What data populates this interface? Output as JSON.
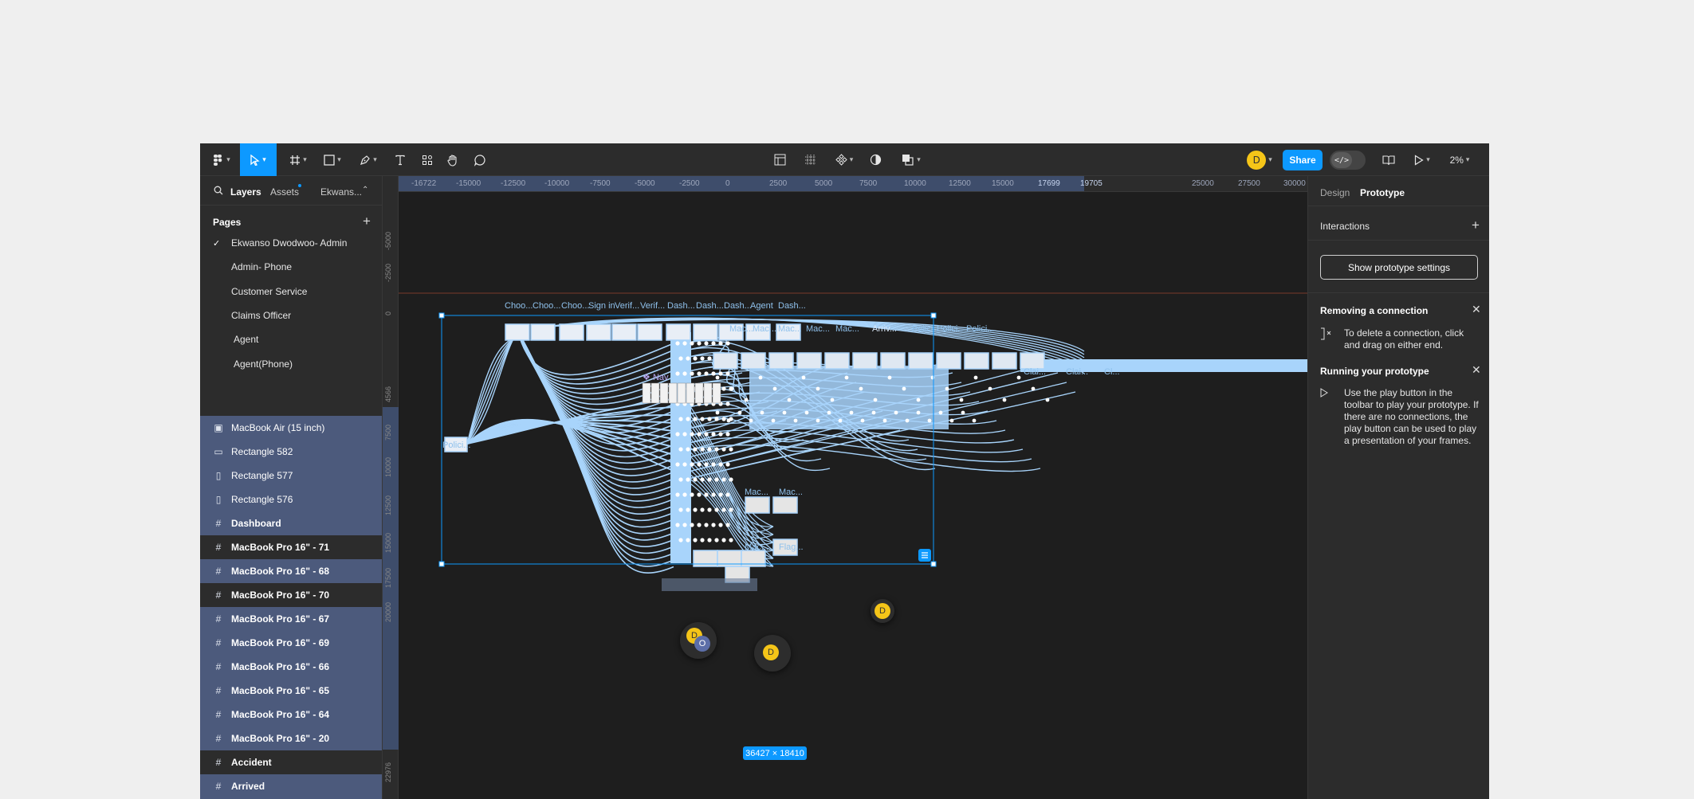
{
  "toolbar": {
    "share_label": "Share",
    "zoom": "2%",
    "user_initial": "D",
    "dev_mode_glyph": "</>"
  },
  "left_panel": {
    "tabs": {
      "layers": "Layers",
      "assets": "Assets",
      "file": "Ekwans..."
    },
    "pages_header": "Pages",
    "pages": [
      {
        "label": "Ekwanso Dwodwoo- Admin",
        "current": true
      },
      {
        "label": "Admin- Phone"
      },
      {
        "label": "Customer Service"
      },
      {
        "label": "Claims Officer"
      },
      {
        "label": "Agent"
      },
      {
        "label": "Agent(Phone)"
      }
    ],
    "layers": [
      {
        "label": "MacBook Air (15 inch)",
        "icon": "image-icon",
        "selected": true
      },
      {
        "label": "Rectangle 582",
        "icon": "rectangle-icon",
        "selected": true
      },
      {
        "label": "Rectangle 577",
        "icon": "rectangle-icon",
        "selected": true
      },
      {
        "label": "Rectangle 576",
        "icon": "rectangle-icon",
        "selected": true
      },
      {
        "label": "Dashboard",
        "icon": "frame-icon",
        "selected": true,
        "bold": true
      },
      {
        "label": "MacBook Pro 16\" - 71",
        "icon": "frame-icon",
        "selected": false,
        "bold": true
      },
      {
        "label": "MacBook Pro 16\" - 68",
        "icon": "frame-icon",
        "selected": true,
        "bold": true
      },
      {
        "label": "MacBook Pro 16\" - 70",
        "icon": "frame-icon",
        "selected": false,
        "bold": true
      },
      {
        "label": "MacBook Pro 16\" - 67",
        "icon": "frame-icon",
        "selected": true,
        "bold": true
      },
      {
        "label": "MacBook Pro 16\" - 69",
        "icon": "frame-icon",
        "selected": true,
        "bold": true
      },
      {
        "label": "MacBook Pro 16\" - 66",
        "icon": "frame-icon",
        "selected": true,
        "bold": true
      },
      {
        "label": "MacBook Pro 16\" - 65",
        "icon": "frame-icon",
        "selected": true,
        "bold": true
      },
      {
        "label": "MacBook Pro 16\" - 64",
        "icon": "frame-icon",
        "selected": true,
        "bold": true
      },
      {
        "label": "MacBook Pro 16\" - 20",
        "icon": "frame-icon",
        "selected": true,
        "bold": true
      },
      {
        "label": "Accident",
        "icon": "frame-icon",
        "selected": false,
        "bold": true
      },
      {
        "label": "Arrived",
        "icon": "frame-icon",
        "selected": true,
        "bold": true
      },
      {
        "label": "Arrived",
        "icon": "frame-icon",
        "selected": true,
        "bold": true
      }
    ]
  },
  "rulers": {
    "horizontal": [
      "-16722",
      "-15000",
      "-12500",
      "-10000",
      "-7500",
      "-5000",
      "-2500",
      "0",
      "2500",
      "5000",
      "7500",
      "10000",
      "12500",
      "15000",
      "17699",
      "19705",
      "25000",
      "27500",
      "30000"
    ],
    "vertical": [
      "-5000",
      "-2500",
      "0",
      "4566",
      "7500",
      "10000",
      "12500",
      "15000",
      "17500",
      "20000",
      "22976"
    ]
  },
  "canvas": {
    "nav_label": "Nav",
    "selection_size": "36427 × 18410",
    "frame_labels": [
      "Choo...",
      "Choo...",
      "Choo...",
      "Sign in",
      "Verif...",
      "Verif...",
      "Dash...",
      "Dash...",
      "Dash...",
      "Agent",
      "Dash...",
      "Mac...",
      "Mac...",
      "Mac...",
      "Mac...",
      "Mac...",
      "Arriv...",
      "Polici...",
      "Polici...",
      "Polici...",
      "Clai...",
      "Clai...",
      "Cl...",
      "Polici...",
      "Mac...",
      "Mac...",
      "Mac...",
      "Flag..."
    ],
    "cursor_initials": [
      "D",
      "O",
      "D",
      "D"
    ]
  },
  "right_panel": {
    "tabs": {
      "design": "Design",
      "prototype": "Prototype"
    },
    "interactions_label": "Interactions",
    "show_settings_button": "Show prototype settings",
    "removing_title": "Removing a connection",
    "removing_text": "To delete a connection, click and drag on either end.",
    "running_title": "Running your prototype",
    "running_text": "Use the play button in the toolbar to play your prototype. If there are no connections, the play button can be used to play a presentation of your frames."
  },
  "colors": {
    "accent": "#0d99ff",
    "selection_row": "#4c5a7c",
    "connector": "#a8d4fb",
    "panel": "#2c2c2c",
    "canvas": "#1e1e1e"
  }
}
